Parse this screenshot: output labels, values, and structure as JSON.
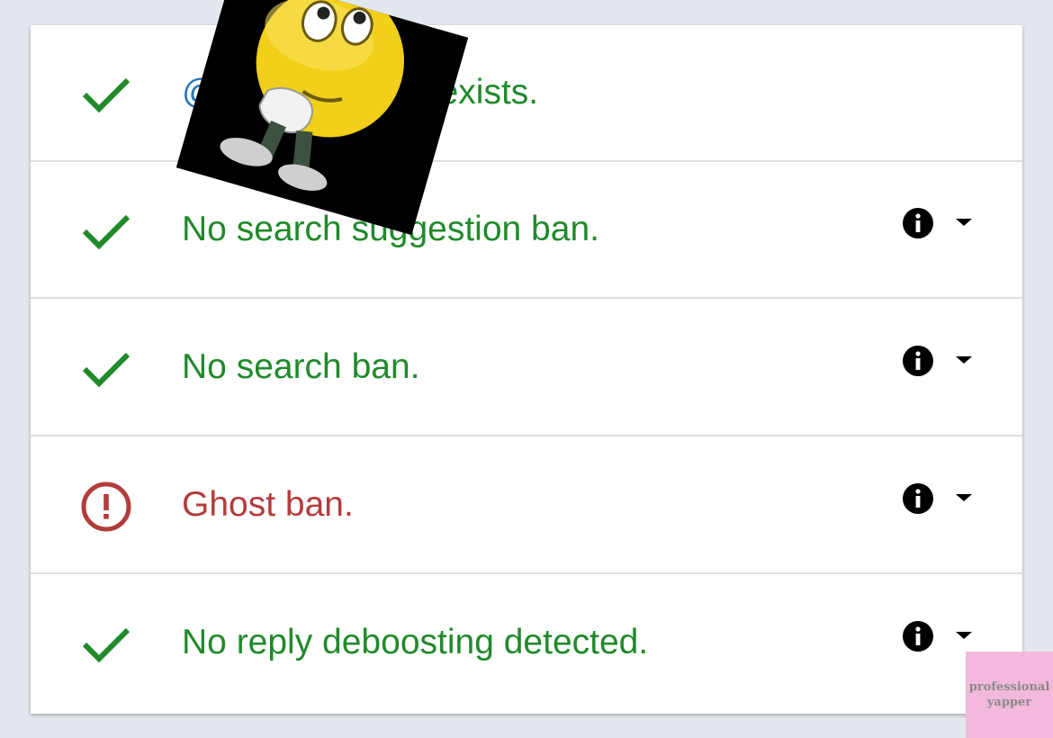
{
  "colors": {
    "page_background": "#e3e8ee",
    "card_background": "#ffffff",
    "ok_green": "#208a2a",
    "error_red": "#b23c3c",
    "link_blue": "#2a7ab8",
    "icon_black": "#000000"
  },
  "checks": [
    {
      "status": "ok",
      "status_icon": "check-icon",
      "text_prefix": "@",
      "text": "exists.",
      "has_details": false
    },
    {
      "status": "ok",
      "status_icon": "check-icon",
      "text": "No search suggestion ban.",
      "has_details": true,
      "info_icon": "info-icon",
      "toggle_icon": "caret-down-icon"
    },
    {
      "status": "ok",
      "status_icon": "check-icon",
      "text": "No search ban.",
      "has_details": true,
      "info_icon": "info-icon",
      "toggle_icon": "caret-down-icon"
    },
    {
      "status": "error",
      "status_icon": "alert-circle-icon",
      "text": "Ghost ban.",
      "has_details": true,
      "info_icon": "info-icon",
      "toggle_icon": "caret-down-icon"
    },
    {
      "status": "ok",
      "status_icon": "check-icon",
      "text": "No reply deboosting detected.",
      "has_details": true,
      "info_icon": "info-icon",
      "toggle_icon": "caret-down-icon"
    }
  ],
  "overlay": {
    "sticker": "thinking-emoji-sticker",
    "watermark_line1": "professional",
    "watermark_line2": "yapper"
  }
}
